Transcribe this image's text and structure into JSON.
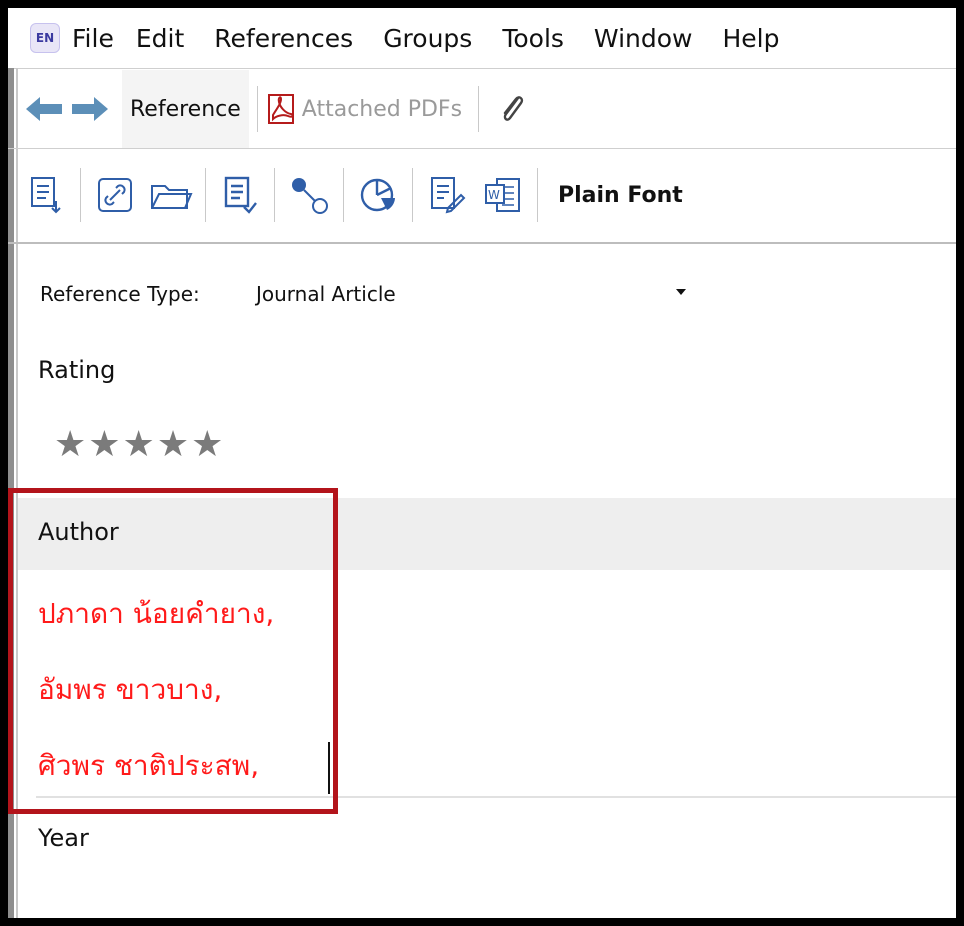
{
  "app": {
    "logo_text": "EN"
  },
  "menu": [
    "File",
    "Edit",
    "References",
    "Groups",
    "Tools",
    "Window",
    "Help"
  ],
  "tabs": [
    "Reference",
    "Attached PDFs"
  ],
  "toolbar": {
    "icons": [
      "insert-citation-icon",
      "link-icon",
      "open-folder-icon",
      "format-bibliography-icon",
      "find-full-text-icon",
      "pie-chart-icon",
      "edit-document-icon",
      "word-document-icon"
    ],
    "font_label": "Plain Font"
  },
  "reference": {
    "type_label": "Reference Type:",
    "type_value": "Journal Article",
    "rating_label": "Rating",
    "rating_stars": "★★★★★",
    "rating_value": 0,
    "author_label": "Author",
    "authors": [
      "ปภาดา น้อยคำยาง,",
      "อัมพร ขาวบาง,",
      "ศิวพร ชาติประสพ,"
    ],
    "year_label": "Year"
  },
  "colors": {
    "author_text": "#ff1a1a",
    "highlight_border": "#b3141b",
    "icon_blue": "#2f5ea8",
    "nav_arrow": "#5c8fb8"
  }
}
